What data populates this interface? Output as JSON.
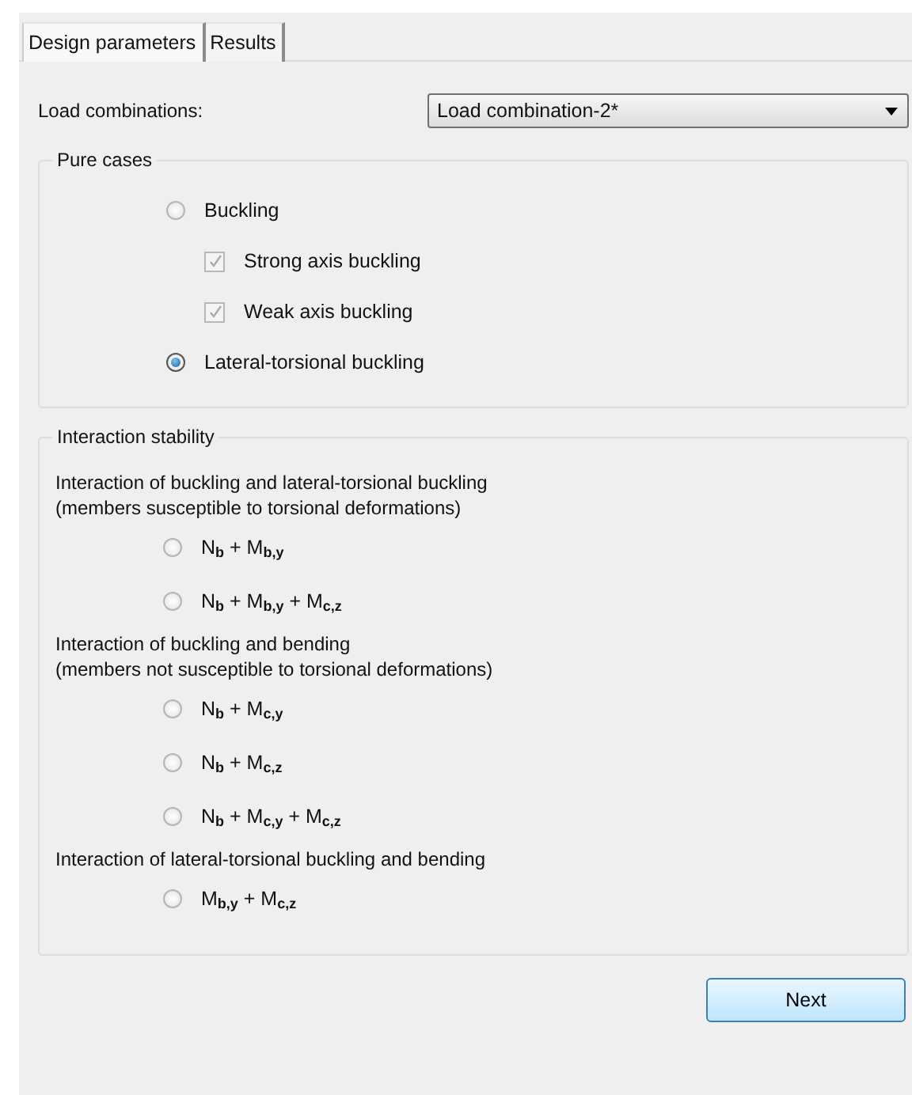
{
  "tabs": [
    {
      "label": "Design parameters",
      "selected": true
    },
    {
      "label": "Results",
      "selected": false
    }
  ],
  "load_combinations": {
    "label": "Load combinations:",
    "value": "Load combination-2*"
  },
  "pure_cases": {
    "title": "Pure cases",
    "items": [
      {
        "kind": "radio",
        "label": "Buckling",
        "selected": false,
        "disabled": false
      },
      {
        "kind": "checkbox",
        "label": "Strong axis buckling",
        "checked": true,
        "disabled": true
      },
      {
        "kind": "checkbox",
        "label": "Weak axis buckling",
        "checked": true,
        "disabled": true
      },
      {
        "kind": "radio",
        "label": "Lateral-torsional buckling",
        "selected": true,
        "disabled": false
      }
    ]
  },
  "interaction_stability": {
    "title": "Interaction stability",
    "items": [
      {
        "kind": "heading",
        "label": "Interaction of buckling and lateral-torsional buckling\n(members susceptible to torsional deformations)"
      },
      {
        "kind": "radio",
        "label": "N$_{b}$ + M$_{b,y}$",
        "selected": false,
        "disabled": false
      },
      {
        "kind": "radio",
        "label": "N$_{b}$ + M$_{b,y}$ + M$_{c,z}$",
        "selected": false,
        "disabled": false
      },
      {
        "kind": "heading",
        "label": "Interaction of buckling and bending\n(members not susceptible to torsional deformations)"
      },
      {
        "kind": "radio",
        "label": "N$_{b}$ + M$_{c,y}$",
        "selected": false,
        "disabled": false
      },
      {
        "kind": "radio",
        "label": "N$_{b}$ + M$_{c,z}$",
        "selected": false,
        "disabled": false
      },
      {
        "kind": "radio",
        "label": "N$_{b}$ + M$_{c,y}$ + M$_{c,z}$",
        "selected": false,
        "disabled": false
      },
      {
        "kind": "heading",
        "label": "Interaction of lateral-torsional buckling and bending"
      },
      {
        "kind": "radio",
        "label": "M$_{b,y}$ + M$_{c,z}$",
        "selected": false,
        "disabled": false
      }
    ]
  },
  "buttons": [
    "Next"
  ]
}
